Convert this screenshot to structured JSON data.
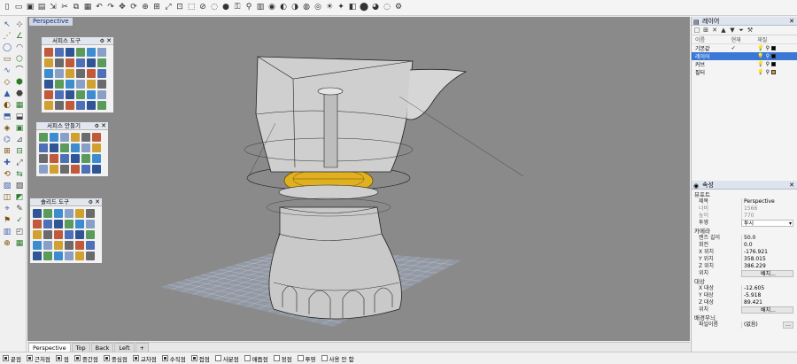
{
  "toolbar": {
    "icons": [
      "new-file",
      "open-file",
      "save-file",
      "print",
      "import",
      "cut",
      "copy",
      "paste",
      "undo",
      "redo",
      "pan",
      "rotate-view",
      "zoom",
      "zoom-window",
      "zoom-extents",
      "zoom-selected",
      "select",
      "deselect",
      "hide",
      "show",
      "lock",
      "unlock",
      "layer",
      "properties",
      "render",
      "render-preview",
      "material",
      "environment",
      "sun",
      "light",
      "display-mode",
      "shaded",
      "rendered",
      "ghost",
      "options"
    ]
  },
  "viewport": {
    "label": "Perspective"
  },
  "palettes": {
    "surface_tools": {
      "title": "서피스 도구",
      "cols": 6,
      "rows": 6
    },
    "surface_create": {
      "title": "서피스 만들기",
      "cols": 6,
      "rows": 4
    },
    "solid_tools": {
      "title": "솔리드 도구",
      "cols": 6,
      "rows": 5
    }
  },
  "tabs": [
    {
      "label": "Perspective",
      "active": true
    },
    {
      "label": "Top",
      "active": false
    },
    {
      "label": "Back",
      "active": false
    },
    {
      "label": "Left",
      "active": false
    },
    {
      "label": "+",
      "active": false
    }
  ],
  "snaps": [
    {
      "label": "끝점",
      "on": true
    },
    {
      "label": "근처점",
      "on": true
    },
    {
      "label": "점",
      "on": true
    },
    {
      "label": "중간점",
      "on": true
    },
    {
      "label": "중심점",
      "on": true
    },
    {
      "label": "교차점",
      "on": true
    },
    {
      "label": "수직점",
      "on": true
    },
    {
      "label": "접점",
      "on": true
    },
    {
      "label": "사분점",
      "on": false
    },
    {
      "label": "매듭점",
      "on": false
    },
    {
      "label": "정점",
      "on": false
    },
    {
      "label": "투영",
      "on": false
    },
    {
      "label": "사용 안 함",
      "on": false
    }
  ],
  "layers": {
    "title": "레이어",
    "columns": {
      "name": "이름",
      "current": "현재",
      "material": "재질"
    },
    "rows": [
      {
        "name": "기본값",
        "current": "✓",
        "color": "#000000",
        "selected": false
      },
      {
        "name": "레이어",
        "current": "",
        "color": "#000000",
        "selected": true
      },
      {
        "name": "커브",
        "current": "",
        "color": "#000000",
        "selected": false
      },
      {
        "name": "필터",
        "current": "",
        "color": "#e09a1c",
        "selected": false
      }
    ]
  },
  "properties": {
    "title": "속성",
    "viewport_section": "뷰포트",
    "title_label": "제목",
    "title_value": "Perspective",
    "width_label": "너비",
    "width_value": "1566",
    "height_label": "높이",
    "height_value": "770",
    "projection_label": "투영",
    "projection_value": "투시",
    "camera_section": "카메라",
    "lens_label": "렌즈 길이",
    "lens_value": "50.0",
    "rotation_label": "회전",
    "rotation_value": "0.0",
    "xpos_label": "X 위치",
    "xpos_value": "-176.921",
    "ypos_label": "Y 위치",
    "ypos_value": "358.015",
    "zpos_label": "Z 위치",
    "zpos_value": "386.229",
    "location_label": "위치",
    "location_button": "배치...",
    "target_section": "대상",
    "xtarget_label": "X 대상",
    "xtarget_value": "-12.605",
    "ytarget_label": "Y 대상",
    "ytarget_value": "-5.918",
    "ztarget_label": "Z 대상",
    "ztarget_value": "89.421",
    "target_location_label": "위치",
    "target_location_button": "배치...",
    "wallpaper_section": "배경무늬",
    "filename_label": "파일이름",
    "filename_value": "(없음)"
  },
  "colors": {
    "viewport_bg": "#8a8a8a",
    "selection": "#3b78d6",
    "highlight": "#e0b020",
    "grid": "#9aa6b8"
  }
}
